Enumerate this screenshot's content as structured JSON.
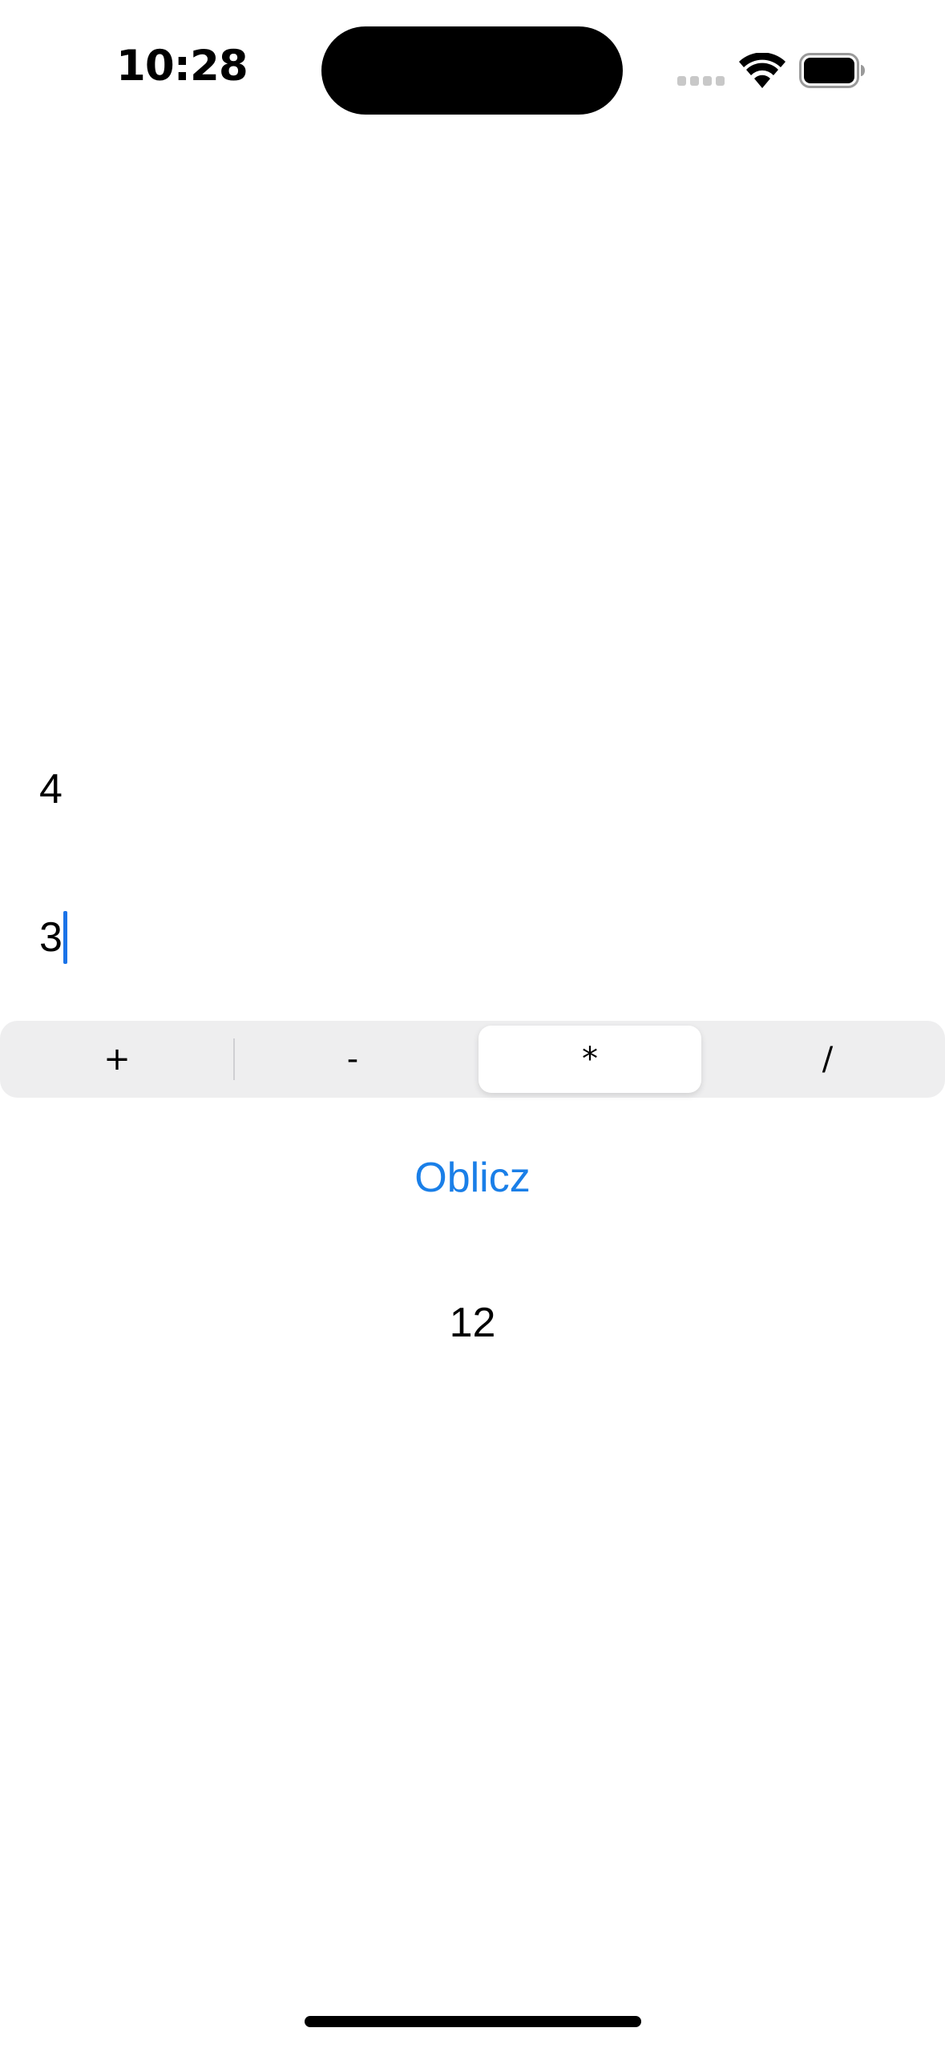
{
  "status_bar": {
    "time": "10:28",
    "signal_icon": "cellular-signal-icon",
    "wifi_icon": "wifi-icon",
    "battery_icon": "battery-icon"
  },
  "calculator": {
    "first_number": "4",
    "second_number": "3",
    "operations": [
      "+",
      "-",
      "*",
      "/"
    ],
    "selected_operation": "*",
    "calculate_label": "Oblicz",
    "result": "12"
  },
  "colors": {
    "accent": "#1a7fe8",
    "segmented_background": "#eeeeef",
    "selected_segment": "#ffffff"
  }
}
